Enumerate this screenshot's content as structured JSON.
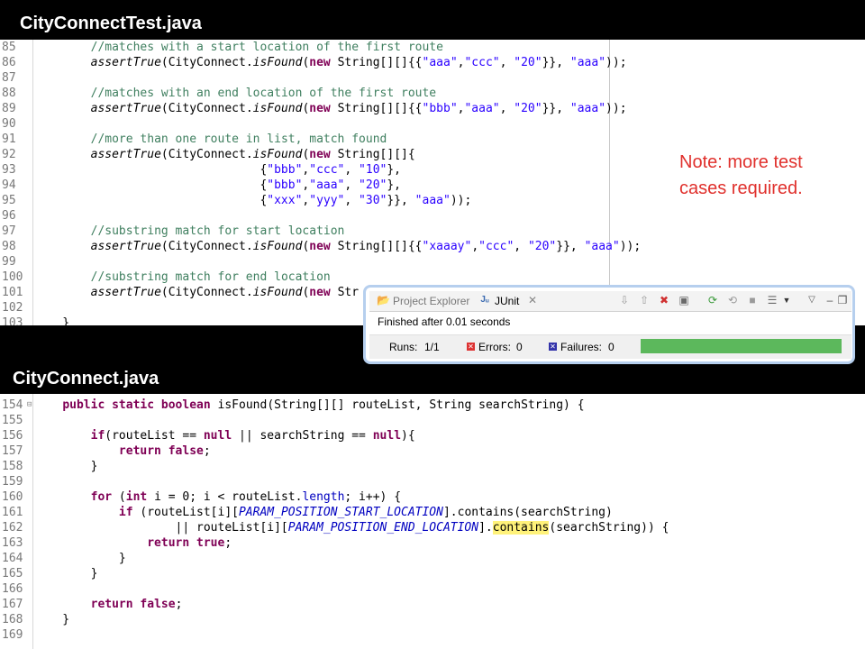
{
  "top_file": {
    "title": "CityConnectTest.java",
    "lines": [
      {
        "n": "85",
        "fold": false,
        "segs": [
          {
            "t": "        "
          },
          {
            "t": "//matches with a start location of the first route",
            "c": "cm"
          }
        ]
      },
      {
        "n": "86",
        "fold": false,
        "segs": [
          {
            "t": "        "
          },
          {
            "t": "assertTrue",
            "c": "it"
          },
          {
            "t": "(CityConnect."
          },
          {
            "t": "isFound",
            "c": "it"
          },
          {
            "t": "("
          },
          {
            "t": "new",
            "c": "kw"
          },
          {
            "t": " String[][]{{"
          },
          {
            "t": "\"aaa\"",
            "c": "st"
          },
          {
            "t": ","
          },
          {
            "t": "\"ccc\"",
            "c": "st"
          },
          {
            "t": ", "
          },
          {
            "t": "\"20\"",
            "c": "st"
          },
          {
            "t": "}}, "
          },
          {
            "t": "\"aaa\"",
            "c": "st"
          },
          {
            "t": "));"
          }
        ]
      },
      {
        "n": "87",
        "fold": false,
        "segs": []
      },
      {
        "n": "88",
        "fold": false,
        "segs": [
          {
            "t": "        "
          },
          {
            "t": "//matches with an end location of the first route",
            "c": "cm"
          }
        ]
      },
      {
        "n": "89",
        "fold": false,
        "segs": [
          {
            "t": "        "
          },
          {
            "t": "assertTrue",
            "c": "it"
          },
          {
            "t": "(CityConnect."
          },
          {
            "t": "isFound",
            "c": "it"
          },
          {
            "t": "("
          },
          {
            "t": "new",
            "c": "kw"
          },
          {
            "t": " String[][]{{"
          },
          {
            "t": "\"bbb\"",
            "c": "st"
          },
          {
            "t": ","
          },
          {
            "t": "\"aaa\"",
            "c": "st"
          },
          {
            "t": ", "
          },
          {
            "t": "\"20\"",
            "c": "st"
          },
          {
            "t": "}}, "
          },
          {
            "t": "\"aaa\"",
            "c": "st"
          },
          {
            "t": "));"
          }
        ]
      },
      {
        "n": "90",
        "fold": false,
        "segs": []
      },
      {
        "n": "91",
        "fold": false,
        "segs": [
          {
            "t": "        "
          },
          {
            "t": "//more than one route in list, match found",
            "c": "cm"
          }
        ]
      },
      {
        "n": "92",
        "fold": false,
        "segs": [
          {
            "t": "        "
          },
          {
            "t": "assertTrue",
            "c": "it"
          },
          {
            "t": "(CityConnect."
          },
          {
            "t": "isFound",
            "c": "it"
          },
          {
            "t": "("
          },
          {
            "t": "new",
            "c": "kw"
          },
          {
            "t": " String[][]{"
          }
        ]
      },
      {
        "n": "93",
        "fold": false,
        "segs": [
          {
            "t": "                                {"
          },
          {
            "t": "\"bbb\"",
            "c": "st"
          },
          {
            "t": ","
          },
          {
            "t": "\"ccc\"",
            "c": "st"
          },
          {
            "t": ", "
          },
          {
            "t": "\"10\"",
            "c": "st"
          },
          {
            "t": "},"
          }
        ]
      },
      {
        "n": "94",
        "fold": false,
        "segs": [
          {
            "t": "                                {"
          },
          {
            "t": "\"bbb\"",
            "c": "st"
          },
          {
            "t": ","
          },
          {
            "t": "\"aaa\"",
            "c": "st"
          },
          {
            "t": ", "
          },
          {
            "t": "\"20\"",
            "c": "st"
          },
          {
            "t": "},"
          }
        ]
      },
      {
        "n": "95",
        "fold": false,
        "segs": [
          {
            "t": "                                {"
          },
          {
            "t": "\"xxx\"",
            "c": "st"
          },
          {
            "t": ","
          },
          {
            "t": "\"yyy\"",
            "c": "st"
          },
          {
            "t": ", "
          },
          {
            "t": "\"30\"",
            "c": "st"
          },
          {
            "t": "}}, "
          },
          {
            "t": "\"aaa\"",
            "c": "st"
          },
          {
            "t": "));"
          }
        ]
      },
      {
        "n": "96",
        "fold": false,
        "segs": []
      },
      {
        "n": "97",
        "fold": false,
        "segs": [
          {
            "t": "        "
          },
          {
            "t": "//substring match for start location",
            "c": "cm"
          }
        ]
      },
      {
        "n": "98",
        "fold": false,
        "segs": [
          {
            "t": "        "
          },
          {
            "t": "assertTrue",
            "c": "it"
          },
          {
            "t": "(CityConnect."
          },
          {
            "t": "isFound",
            "c": "it"
          },
          {
            "t": "("
          },
          {
            "t": "new",
            "c": "kw"
          },
          {
            "t": " String[][]{{"
          },
          {
            "t": "\"xaaay\"",
            "c": "st"
          },
          {
            "t": ","
          },
          {
            "t": "\"ccc\"",
            "c": "st"
          },
          {
            "t": ", "
          },
          {
            "t": "\"20\"",
            "c": "st"
          },
          {
            "t": "}}, "
          },
          {
            "t": "\"aaa\"",
            "c": "st"
          },
          {
            "t": "));"
          }
        ]
      },
      {
        "n": "99",
        "fold": false,
        "segs": []
      },
      {
        "n": "100",
        "fold": false,
        "segs": [
          {
            "t": "        "
          },
          {
            "t": "//substring match for end location",
            "c": "cm"
          }
        ]
      },
      {
        "n": "101",
        "fold": false,
        "segs": [
          {
            "t": "        "
          },
          {
            "t": "assertTrue",
            "c": "it"
          },
          {
            "t": "(CityConnect."
          },
          {
            "t": "isFound",
            "c": "it"
          },
          {
            "t": "("
          },
          {
            "t": "new",
            "c": "kw"
          },
          {
            "t": " Str"
          }
        ]
      },
      {
        "n": "102",
        "fold": false,
        "segs": []
      },
      {
        "n": "103",
        "fold": false,
        "segs": [
          {
            "t": "    }"
          }
        ]
      }
    ]
  },
  "note": "Note: more test cases required.",
  "junit": {
    "tabs": {
      "project_explorer": "Project Explorer",
      "junit": "JUnit"
    },
    "status": "Finished after 0.01 seconds",
    "runs_label": "Runs:",
    "runs_value": "1/1",
    "errors_label": "Errors:",
    "errors_value": "0",
    "failures_label": "Failures:",
    "failures_value": "0",
    "progress_fraction": 1.0,
    "progress_color": "#5cb85c"
  },
  "bottom_file": {
    "title": "CityConnect.java",
    "lines": [
      {
        "n": "154",
        "fold": true,
        "segs": [
          {
            "t": "    "
          },
          {
            "t": "public",
            "c": "kw"
          },
          {
            "t": " "
          },
          {
            "t": "static",
            "c": "kw"
          },
          {
            "t": " "
          },
          {
            "t": "boolean",
            "c": "kw"
          },
          {
            "t": " isFound(String[][] routeList, String searchString) {"
          }
        ]
      },
      {
        "n": "155",
        "fold": false,
        "segs": []
      },
      {
        "n": "156",
        "fold": false,
        "segs": [
          {
            "t": "        "
          },
          {
            "t": "if",
            "c": "kw"
          },
          {
            "t": "(routeList == "
          },
          {
            "t": "null",
            "c": "kw"
          },
          {
            "t": " || searchString == "
          },
          {
            "t": "null",
            "c": "kw"
          },
          {
            "t": "){"
          }
        ]
      },
      {
        "n": "157",
        "fold": false,
        "segs": [
          {
            "t": "            "
          },
          {
            "t": "return",
            "c": "kw"
          },
          {
            "t": " "
          },
          {
            "t": "false",
            "c": "kw"
          },
          {
            "t": ";"
          }
        ]
      },
      {
        "n": "158",
        "fold": false,
        "segs": [
          {
            "t": "        }"
          }
        ]
      },
      {
        "n": "159",
        "fold": false,
        "segs": []
      },
      {
        "n": "160",
        "fold": false,
        "segs": [
          {
            "t": "        "
          },
          {
            "t": "for",
            "c": "kw"
          },
          {
            "t": " ("
          },
          {
            "t": "int",
            "c": "kw"
          },
          {
            "t": " i = 0; i < routeList."
          },
          {
            "t": "length",
            "c": "fld2"
          },
          {
            "t": "; i++) {"
          }
        ]
      },
      {
        "n": "161",
        "fold": false,
        "segs": [
          {
            "t": "            "
          },
          {
            "t": "if",
            "c": "kw"
          },
          {
            "t": " (routeList[i]["
          },
          {
            "t": "PARAM_POSITION_START_LOCATION",
            "c": "fld"
          },
          {
            "t": "].contains(searchString)"
          }
        ]
      },
      {
        "n": "162",
        "fold": false,
        "segs": [
          {
            "t": "                    || routeList[i]["
          },
          {
            "t": "PARAM_POSITION_END_LOCATION",
            "c": "fld"
          },
          {
            "t": "]."
          },
          {
            "t": "contains",
            "c": "hl"
          },
          {
            "t": "(searchString)) {"
          }
        ]
      },
      {
        "n": "163",
        "fold": false,
        "segs": [
          {
            "t": "                "
          },
          {
            "t": "return",
            "c": "kw"
          },
          {
            "t": " "
          },
          {
            "t": "true",
            "c": "kw"
          },
          {
            "t": ";"
          }
        ]
      },
      {
        "n": "164",
        "fold": false,
        "segs": [
          {
            "t": "            }"
          }
        ]
      },
      {
        "n": "165",
        "fold": false,
        "segs": [
          {
            "t": "        }"
          }
        ]
      },
      {
        "n": "166",
        "fold": false,
        "segs": []
      },
      {
        "n": "167",
        "fold": false,
        "segs": [
          {
            "t": "        "
          },
          {
            "t": "return",
            "c": "kw"
          },
          {
            "t": " "
          },
          {
            "t": "false",
            "c": "kw"
          },
          {
            "t": ";"
          }
        ]
      },
      {
        "n": "168",
        "fold": false,
        "segs": [
          {
            "t": "    }"
          }
        ]
      },
      {
        "n": "169",
        "fold": false,
        "segs": []
      }
    ]
  }
}
